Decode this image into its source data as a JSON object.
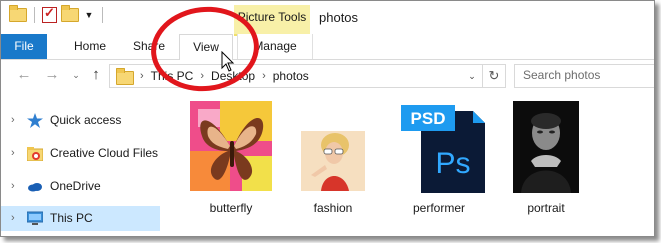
{
  "window": {
    "title": "photos",
    "context_tab": "Picture Tools"
  },
  "ribbon": {
    "tabs": [
      {
        "label": "File"
      },
      {
        "label": "Home"
      },
      {
        "label": "Share"
      },
      {
        "label": "View"
      },
      {
        "label": "Manage"
      }
    ]
  },
  "address": {
    "crumbs": [
      "This PC",
      "Desktop",
      "photos"
    ]
  },
  "search": {
    "placeholder": "Search photos"
  },
  "sidebar": {
    "items": [
      {
        "label": "Quick access",
        "icon": "star-icon"
      },
      {
        "label": "Creative Cloud Files",
        "icon": "creative-cloud-folder-icon"
      },
      {
        "label": "OneDrive",
        "icon": "cloud-icon"
      },
      {
        "label": "This PC",
        "icon": "monitor-icon",
        "selected": true
      }
    ]
  },
  "files": [
    {
      "name": "butterfly"
    },
    {
      "name": "fashion"
    },
    {
      "name": "performer",
      "badge": "PSD",
      "glyph": "Ps"
    },
    {
      "name": "portrait"
    }
  ],
  "colors": {
    "file_tab": "#1979ca",
    "context_tab": "#f8f0a8",
    "selection": "#cce8ff",
    "annotation": "#e1161c",
    "psd_blue": "#1e9bf0"
  }
}
